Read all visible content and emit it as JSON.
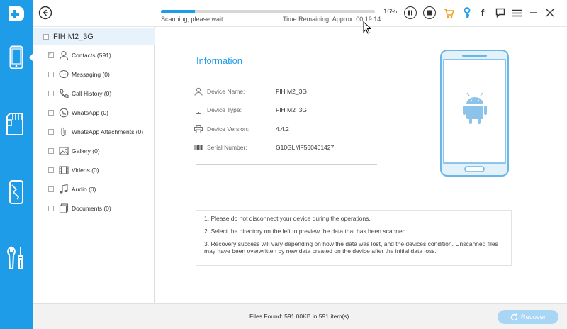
{
  "app": {
    "accent_color": "#1e9ce8",
    "logo_icon": "plus-cross-icon"
  },
  "rail": {
    "items": [
      {
        "name": "phone-icon",
        "active": true
      },
      {
        "name": "sd-card-icon",
        "active": false
      },
      {
        "name": "broken-phone-icon",
        "active": false
      },
      {
        "name": "tools-icon",
        "active": false
      }
    ]
  },
  "topbar": {
    "progress_percent": 16,
    "progress_label": "16%",
    "scan_status": "Scanning, please wait...",
    "time_remaining": "Time Remaining: Approx. 00:19:14",
    "icons": [
      "pause-icon",
      "stop-icon",
      "cart-icon",
      "key-icon",
      "facebook-icon",
      "chat-icon",
      "menu-icon",
      "minimize-icon",
      "close-icon"
    ]
  },
  "tree": {
    "device_name": "FIH  M2_3G",
    "items": [
      {
        "label": "Contacts (591)",
        "icon": "contact-icon",
        "checked": true
      },
      {
        "label": "Messaging (0)",
        "icon": "message-icon",
        "checked": false
      },
      {
        "label": "Call History (0)",
        "icon": "call-history-icon",
        "checked": false
      },
      {
        "label": "WhatsApp (0)",
        "icon": "whatsapp-icon",
        "checked": false
      },
      {
        "label": "WhatsApp Attachments (0)",
        "icon": "attachment-icon",
        "checked": false
      },
      {
        "label": "Gallery (0)",
        "icon": "gallery-icon",
        "checked": false
      },
      {
        "label": "Videos (0)",
        "icon": "video-icon",
        "checked": false
      },
      {
        "label": "Audio (0)",
        "icon": "audio-icon",
        "checked": false
      },
      {
        "label": "Documents (0)",
        "icon": "documents-icon",
        "checked": false
      }
    ]
  },
  "info": {
    "title": "Information",
    "rows": [
      {
        "key": "Device Name:",
        "value": "FIH  M2_3G",
        "icon": "user-icon"
      },
      {
        "key": "Device Type:",
        "value": "FIH  M2_3G",
        "icon": "device-icon"
      },
      {
        "key": "Device Version:",
        "value": "4.4.2",
        "icon": "printer-icon"
      },
      {
        "key": "Serial Number:",
        "value": "G10GLMF560401427",
        "icon": "barcode-icon"
      }
    ]
  },
  "notes": [
    "1. Please do not disconnect your device during the operations.",
    "2. Select the directory on the left to preview the data that has been scanned.",
    "3. Recovery success will vary depending on how the data was lost, and the devices condition. Unscanned files may have been overwritten by new data created on the device after the initial data loss."
  ],
  "footer": {
    "files_found": "Files Found: 591.00KB in 591 item(s)",
    "recover_label": "Recover"
  }
}
